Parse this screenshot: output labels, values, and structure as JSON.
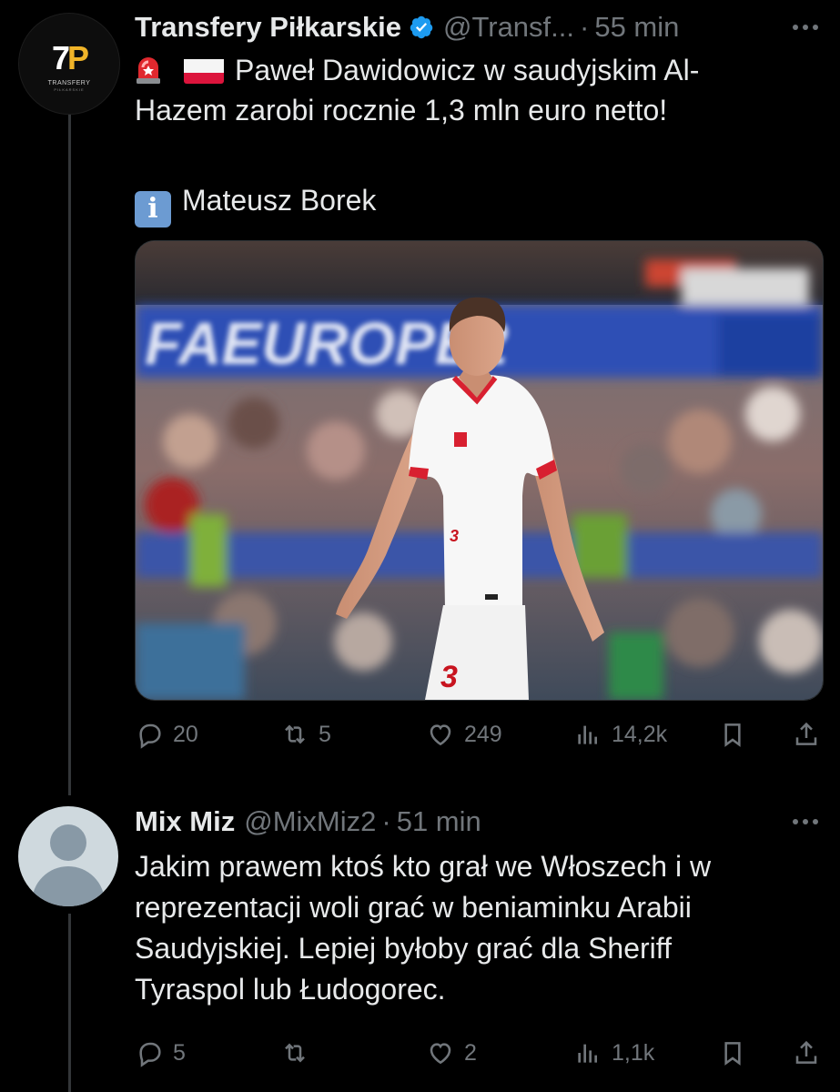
{
  "tweet1": {
    "author_name": "Transfery Piłkarskie",
    "handle": "@Transf...",
    "separator": "·",
    "time": "55 min",
    "avatar_logo": "7P",
    "avatar_logo_text": "TRANSFERY",
    "avatar_logo_subtext": "PIŁKARSKIE",
    "line1": "Paweł Dawidowicz w saudyjskim Al-",
    "line2": "Hazem zarobi rocznie 1,3 mln euro netto!",
    "source": "Mateusz Borek",
    "icons": [
      "rotating-light-emoji",
      "poland-flag-emoji",
      "information-emoji",
      "verified-badge-icon"
    ],
    "actions": {
      "replies": "20",
      "reposts": "5",
      "likes": "249",
      "views": "14,2k"
    }
  },
  "tweet2": {
    "author_name": "Mix Miz",
    "handle": "@MixMiz2",
    "separator": "·",
    "time": "51 min",
    "lines": [
      "Jakim prawem ktoś kto grał we Włoszech i w",
      "reprezentacji woli grać w beniaminku Arabii",
      "Saudyjskiej. Lepiej byłoby grać dla Sheriff",
      "Tyraspol lub Łudogorec."
    ],
    "actions": {
      "replies": "5",
      "reposts": "",
      "likes": "2",
      "views": "1,1k"
    }
  },
  "colors": {
    "background": "#000000",
    "text": "#e7e9ea",
    "muted": "#71767b",
    "verified": "#1d9bf0",
    "thread_line": "#333639"
  }
}
